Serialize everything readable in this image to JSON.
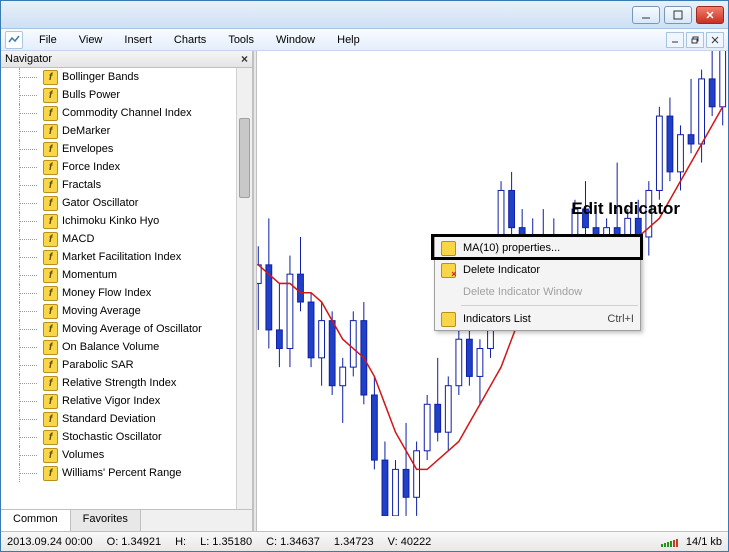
{
  "menubar": {
    "items": [
      "File",
      "View",
      "Insert",
      "Charts",
      "Tools",
      "Window",
      "Help"
    ]
  },
  "navigator": {
    "title": "Navigator",
    "tabs": {
      "common": "Common",
      "favorites": "Favorites"
    },
    "items": [
      "Bollinger Bands",
      "Bulls Power",
      "Commodity Channel Index",
      "DeMarker",
      "Envelopes",
      "Force Index",
      "Fractals",
      "Gator Oscillator",
      "Ichimoku Kinko Hyo",
      "MACD",
      "Market Facilitation Index",
      "Momentum",
      "Money Flow Index",
      "Moving Average",
      "Moving Average of Oscillator",
      "On Balance Volume",
      "Parabolic SAR",
      "Relative Strength Index",
      "Relative Vigor Index",
      "Standard Deviation",
      "Stochastic Oscillator",
      "Volumes",
      "Williams' Percent Range"
    ]
  },
  "context_menu": {
    "properties": "MA(10) properties...",
    "delete": "Delete Indicator",
    "delete_window": "Delete Indicator Window",
    "list": "Indicators List",
    "list_shortcut": "Ctrl+I"
  },
  "annotation": "Edit Indicator",
  "statusbar": {
    "datetime": "2013.09.24 00:00",
    "open": "O: 1.34921",
    "high": "H:",
    "low": "L: 1.35180",
    "close": "C: 1.34637",
    "change": "1.34723",
    "volume": "V: 40222",
    "kb": "14/1 kb"
  },
  "chart_data": {
    "type": "candlestick+line",
    "x_count": 50,
    "y_range": [
      1.32,
      1.37
    ],
    "indicator_line": {
      "name": "MA(10)",
      "color": "#d01818"
    },
    "colors": {
      "up_candle": "#ffffff",
      "down_candle": "#2040c8",
      "wick": "#1020a8"
    },
    "ohlc_approx": [
      {
        "o": 1.345,
        "h": 1.349,
        "l": 1.34,
        "c": 1.347
      },
      {
        "o": 1.347,
        "h": 1.352,
        "l": 1.338,
        "c": 1.34
      },
      {
        "o": 1.34,
        "h": 1.345,
        "l": 1.336,
        "c": 1.338
      },
      {
        "o": 1.338,
        "h": 1.348,
        "l": 1.336,
        "c": 1.346
      },
      {
        "o": 1.346,
        "h": 1.35,
        "l": 1.342,
        "c": 1.343
      },
      {
        "o": 1.343,
        "h": 1.344,
        "l": 1.336,
        "c": 1.337
      },
      {
        "o": 1.337,
        "h": 1.343,
        "l": 1.334,
        "c": 1.341
      },
      {
        "o": 1.341,
        "h": 1.342,
        "l": 1.333,
        "c": 1.334
      },
      {
        "o": 1.334,
        "h": 1.337,
        "l": 1.33,
        "c": 1.336
      },
      {
        "o": 1.336,
        "h": 1.342,
        "l": 1.335,
        "c": 1.341
      },
      {
        "o": 1.341,
        "h": 1.343,
        "l": 1.332,
        "c": 1.333
      },
      {
        "o": 1.333,
        "h": 1.335,
        "l": 1.325,
        "c": 1.326
      },
      {
        "o": 1.326,
        "h": 1.328,
        "l": 1.318,
        "c": 1.32
      },
      {
        "o": 1.32,
        "h": 1.326,
        "l": 1.318,
        "c": 1.325
      },
      {
        "o": 1.325,
        "h": 1.33,
        "l": 1.32,
        "c": 1.322
      },
      {
        "o": 1.322,
        "h": 1.328,
        "l": 1.32,
        "c": 1.327
      },
      {
        "o": 1.327,
        "h": 1.333,
        "l": 1.326,
        "c": 1.332
      },
      {
        "o": 1.332,
        "h": 1.337,
        "l": 1.328,
        "c": 1.329
      },
      {
        "o": 1.329,
        "h": 1.335,
        "l": 1.327,
        "c": 1.334
      },
      {
        "o": 1.334,
        "h": 1.34,
        "l": 1.333,
        "c": 1.339
      },
      {
        "o": 1.339,
        "h": 1.341,
        "l": 1.334,
        "c": 1.335
      },
      {
        "o": 1.335,
        "h": 1.339,
        "l": 1.332,
        "c": 1.338
      },
      {
        "o": 1.338,
        "h": 1.347,
        "l": 1.337,
        "c": 1.346
      },
      {
        "o": 1.346,
        "h": 1.356,
        "l": 1.345,
        "c": 1.355
      },
      {
        "o": 1.355,
        "h": 1.357,
        "l": 1.35,
        "c": 1.351
      },
      {
        "o": 1.351,
        "h": 1.353,
        "l": 1.345,
        "c": 1.347
      },
      {
        "o": 1.347,
        "h": 1.352,
        "l": 1.343,
        "c": 1.35
      },
      {
        "o": 1.35,
        "h": 1.353,
        "l": 1.347,
        "c": 1.348
      },
      {
        "o": 1.348,
        "h": 1.352,
        "l": 1.344,
        "c": 1.345
      },
      {
        "o": 1.345,
        "h": 1.35,
        "l": 1.342,
        "c": 1.349
      },
      {
        "o": 1.349,
        "h": 1.354,
        "l": 1.347,
        "c": 1.353
      },
      {
        "o": 1.353,
        "h": 1.356,
        "l": 1.35,
        "c": 1.351
      },
      {
        "o": 1.351,
        "h": 1.353,
        "l": 1.345,
        "c": 1.346
      },
      {
        "o": 1.346,
        "h": 1.352,
        "l": 1.343,
        "c": 1.351
      },
      {
        "o": 1.351,
        "h": 1.358,
        "l": 1.348,
        "c": 1.349
      },
      {
        "o": 1.349,
        "h": 1.353,
        "l": 1.346,
        "c": 1.352
      },
      {
        "o": 1.352,
        "h": 1.354,
        "l": 1.349,
        "c": 1.35
      },
      {
        "o": 1.35,
        "h": 1.356,
        "l": 1.348,
        "c": 1.355
      },
      {
        "o": 1.355,
        "h": 1.364,
        "l": 1.354,
        "c": 1.363
      },
      {
        "o": 1.363,
        "h": 1.365,
        "l": 1.356,
        "c": 1.357
      },
      {
        "o": 1.357,
        "h": 1.362,
        "l": 1.355,
        "c": 1.361
      },
      {
        "o": 1.361,
        "h": 1.367,
        "l": 1.359,
        "c": 1.36
      },
      {
        "o": 1.36,
        "h": 1.368,
        "l": 1.358,
        "c": 1.367
      },
      {
        "o": 1.367,
        "h": 1.37,
        "l": 1.363,
        "c": 1.364
      },
      {
        "o": 1.364,
        "h": 1.372,
        "l": 1.362,
        "c": 1.371
      }
    ],
    "ma10": [
      1.347,
      1.346,
      1.345,
      1.345,
      1.344,
      1.344,
      1.343,
      1.341,
      1.339,
      1.338,
      1.337,
      1.335,
      1.332,
      1.329,
      1.327,
      1.325,
      1.325,
      1.326,
      1.327,
      1.328,
      1.33,
      1.332,
      1.334,
      1.336,
      1.339,
      1.342,
      1.345,
      1.347,
      1.349,
      1.349,
      1.349,
      1.349,
      1.349,
      1.349,
      1.349,
      1.35,
      1.35,
      1.351,
      1.352,
      1.354,
      1.356,
      1.358,
      1.36,
      1.362,
      1.364
    ]
  }
}
